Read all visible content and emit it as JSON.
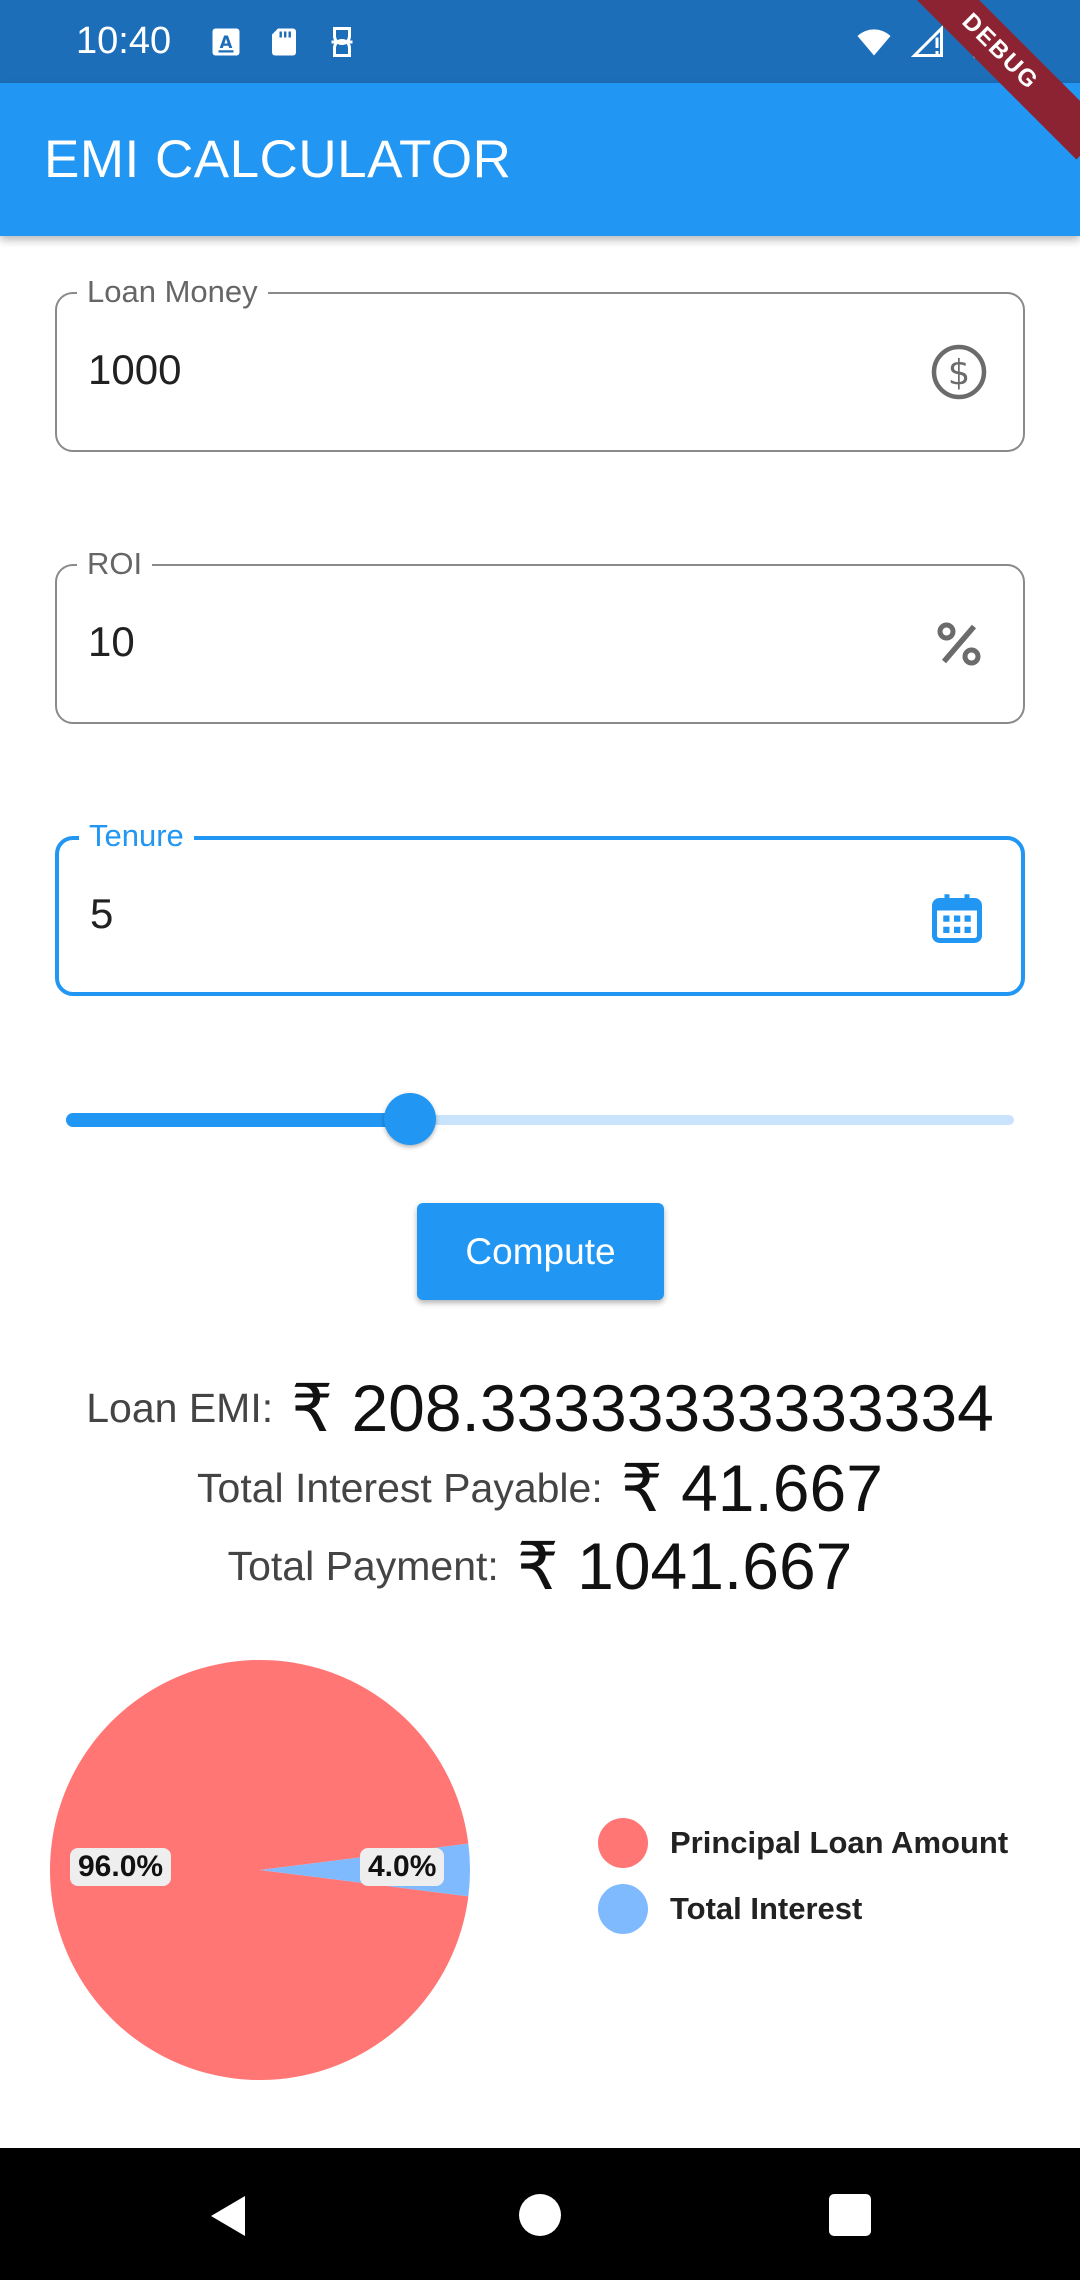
{
  "status_bar": {
    "time": "10:40",
    "left_icons": [
      "font-a-icon",
      "sd-card-icon",
      "vpn-key-icon"
    ],
    "right_icons": [
      "wifi-icon",
      "signal-icon",
      "battery-icon"
    ]
  },
  "debug_banner": "DEBUG",
  "app_bar": {
    "title": "EMI CALCULATOR"
  },
  "fields": {
    "loan_money": {
      "label": "Loan Money",
      "value": "1000",
      "icon": "dollar-circle-icon"
    },
    "roi": {
      "label": "ROI",
      "value": "10",
      "icon": "percent-icon"
    },
    "tenure": {
      "label": "Tenure",
      "value": "5",
      "icon": "calendar-icon"
    }
  },
  "slider": {
    "value_fraction": 0.363
  },
  "compute_button": {
    "label": "Compute"
  },
  "results": {
    "loan_emi": {
      "label": "Loan EMI:",
      "value": "₹ 208.33333333333334"
    },
    "total_interest": {
      "label": "Total Interest Payable:",
      "value": "₹ 41.667"
    },
    "total_payment": {
      "label": "Total Payment:",
      "value": "₹ 1041.667"
    }
  },
  "chart_data": {
    "type": "pie",
    "series": [
      {
        "name": "Principal Loan Amount",
        "value": 96.0,
        "label": "96.0%",
        "color": "#ff7675"
      },
      {
        "name": "Total Interest",
        "value": 4.0,
        "label": "4.0%",
        "color": "#7fbaff"
      }
    ],
    "legend_position": "right"
  },
  "colors": {
    "primary": "#2196f3",
    "status_bar": "#1c6eb8",
    "principal": "#ff7675",
    "interest": "#7fbaff"
  },
  "nav_bar": {
    "icons": [
      "back-icon",
      "home-icon",
      "recents-icon"
    ]
  }
}
